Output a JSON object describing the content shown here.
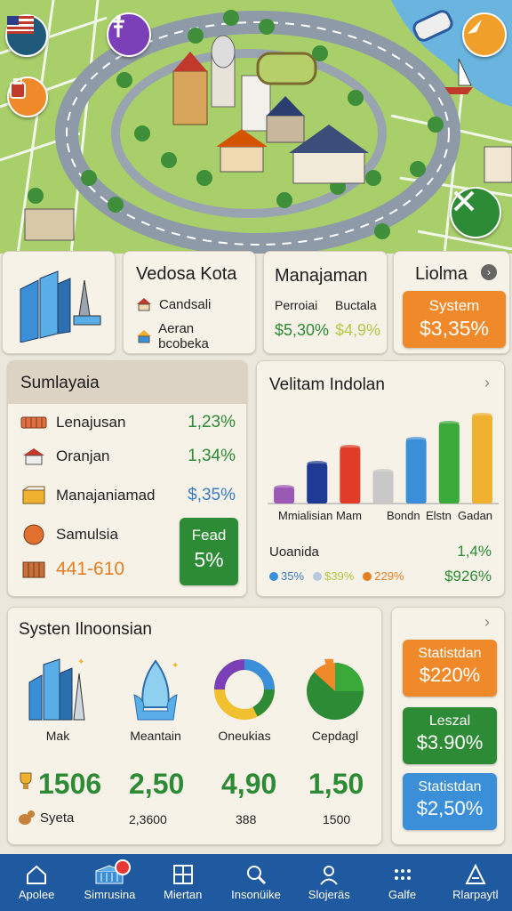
{
  "colors": {
    "green": "#2e8b35",
    "orange": "#f0892a",
    "blue": "#3a7cc4",
    "nav": "#1f5aa0"
  },
  "map": {
    "buttons": [
      {
        "name": "flag-icon"
      },
      {
        "name": "map-pin-icon"
      },
      {
        "name": "backpack-icon"
      },
      {
        "name": "compass-icon"
      },
      {
        "name": "tools-icon"
      }
    ]
  },
  "top_cards": {
    "city": {
      "title": "Vedosa Kota",
      "items": [
        {
          "icon": "house-icon",
          "label": "Candsali"
        },
        {
          "icon": "house-icon",
          "label": "Aeran bcobeka"
        }
      ]
    },
    "manajaman": {
      "title": "Manajaman",
      "col1_label": "Perroiai",
      "col1_value": "$5,30%",
      "col2_label": "Buctala",
      "col2_value": "$4,9%"
    },
    "liolma": {
      "title": "Liolma",
      "system_label": "System",
      "system_value": "$3,35%"
    }
  },
  "summary": {
    "title": "Sumlayaia",
    "rows": [
      {
        "icon": "bench-icon",
        "label": "Lenajusan",
        "value": "1,23%"
      },
      {
        "icon": "house-icon",
        "label": "Oranjan",
        "value": "1,34%"
      },
      {
        "icon": "package-icon",
        "label": "Manajaniamad",
        "value": "$,35%"
      },
      {
        "icon": "ball-icon",
        "label": "Samulsia",
        "value": ""
      }
    ],
    "bottom_value": "441-610",
    "feed_label": "Fead",
    "feed_value": "5%"
  },
  "chart_panel": {
    "title": "Velitam Indolan",
    "footer_label": "Uoanida",
    "footer_value": "1,4%",
    "legend": [
      {
        "text": "35%",
        "color": "#3a8fd8"
      },
      {
        "text": "$39%",
        "color": "#b7c9dd"
      },
      {
        "text": "229%",
        "color": "#e67e22"
      }
    ],
    "legend_value": "$926%"
  },
  "chart_data": {
    "type": "bar",
    "title": "Velitam Indolan",
    "categories": [
      "",
      "",
      "",
      "",
      "",
      "",
      ""
    ],
    "tick_labels": [
      "Mmialisian Mam",
      "Bondn",
      "Elstn",
      "Gadan"
    ],
    "values": [
      2,
      5,
      7,
      4,
      8,
      10,
      11
    ],
    "colors": [
      "#9b59b6",
      "#1f3a93",
      "#e03c28",
      "#c8c8c8",
      "#3a8fd8",
      "#3aa93a",
      "#f0b030"
    ],
    "ylim": [
      0,
      12
    ],
    "grid": false
  },
  "system_panel": {
    "title": "Systen Ilnoonsian",
    "icons": [
      {
        "name": "skyscrapers-icon",
        "label": "Mak"
      },
      {
        "name": "crystal-icon",
        "label": "Meantain"
      },
      {
        "name": "donut-chart-icon",
        "label": "Oneukias"
      },
      {
        "name": "pie-chart-icon",
        "label": "Cepdagl"
      }
    ],
    "stats": [
      {
        "value": "1506",
        "sub": "Syeta"
      },
      {
        "value": "2,50",
        "sub": "2,3600"
      },
      {
        "value": "4,90",
        "sub": "388"
      },
      {
        "value": "1,50",
        "sub": "1500"
      }
    ]
  },
  "stat_buttons": [
    {
      "label": "Statistdan",
      "value": "$220%",
      "color": "#f0892a"
    },
    {
      "label": "Leszal",
      "value": "$3.90%",
      "color": "#2e8b35"
    },
    {
      "label": "Statistdan",
      "value": "$2,50%",
      "color": "#3a8fd8"
    }
  ],
  "nav": [
    {
      "icon": "home-icon",
      "label": "Apolee"
    },
    {
      "icon": "buildings-icon",
      "label": "Simrusina"
    },
    {
      "icon": "grid-icon",
      "label": "Miertan"
    },
    {
      "icon": "search-icon",
      "label": "Insonüike"
    },
    {
      "icon": "person-icon",
      "label": "Slojeräs"
    },
    {
      "icon": "apps-icon",
      "label": "Galfe"
    },
    {
      "icon": "triangle-icon",
      "label": "Rlarpaytl"
    }
  ]
}
